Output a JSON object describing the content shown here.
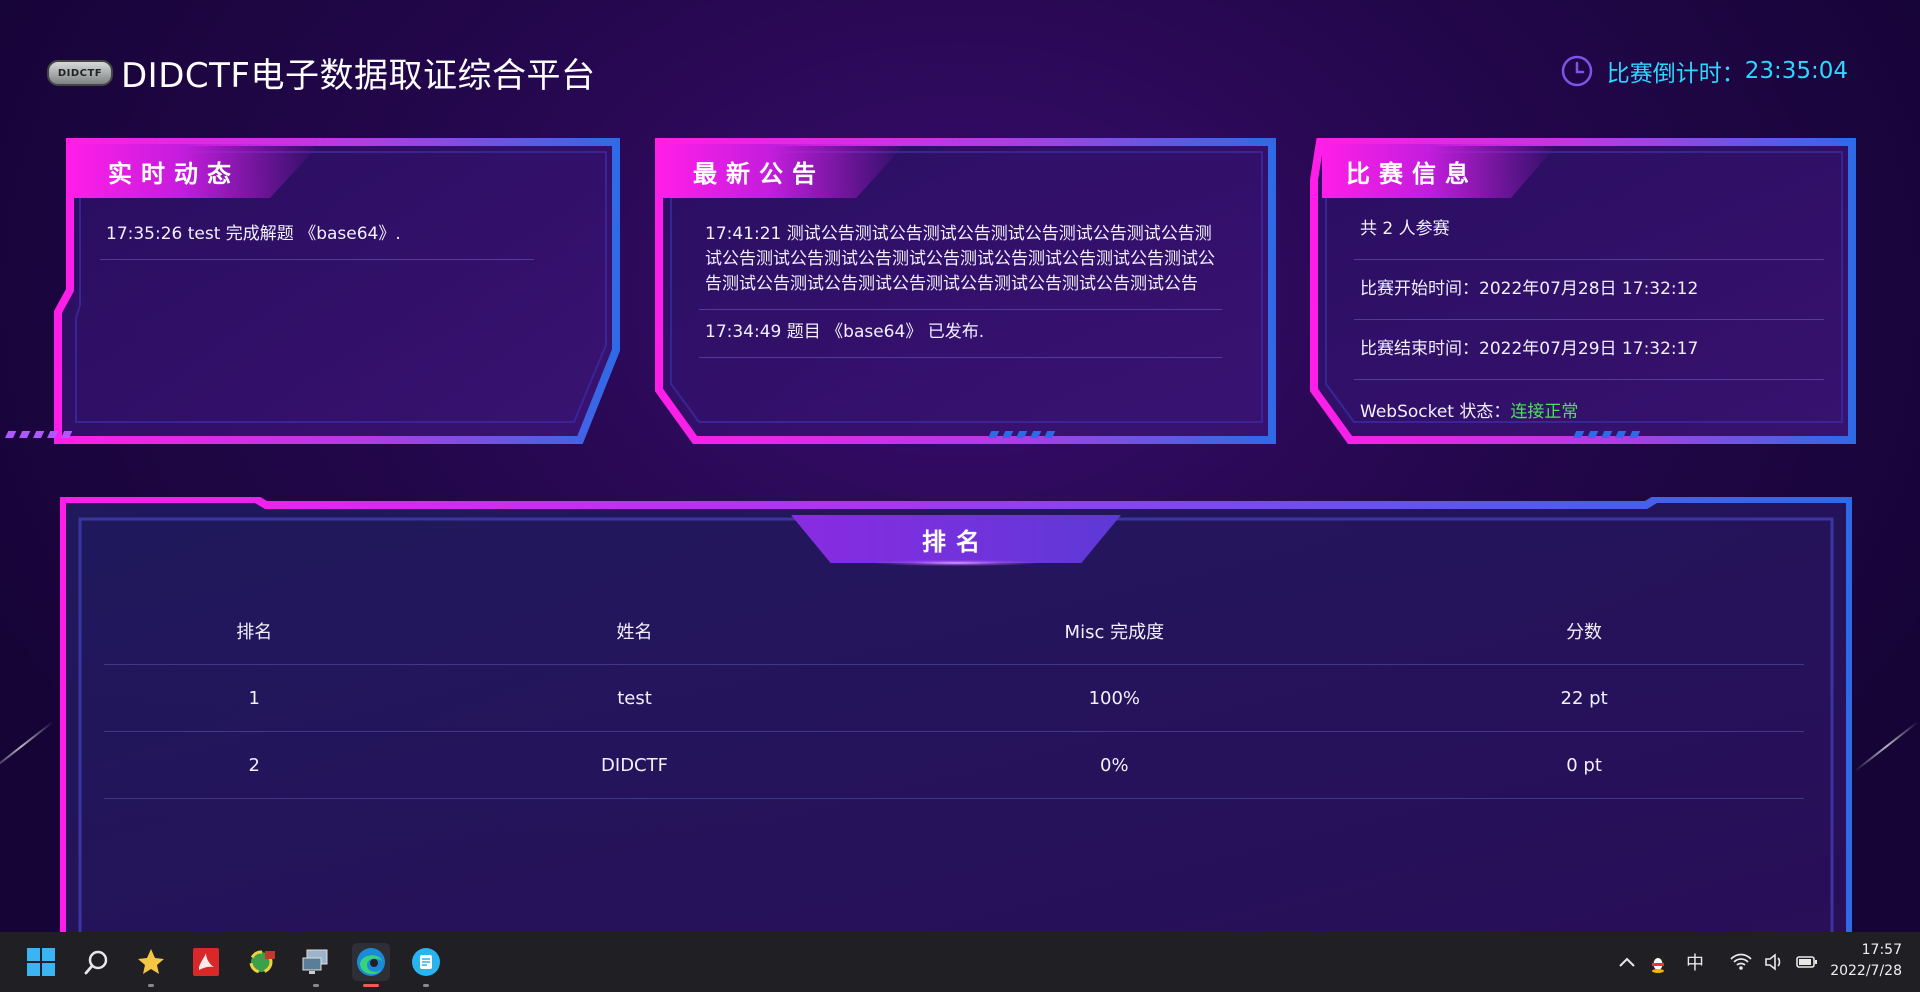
{
  "header": {
    "logo_text": "DIDCTF",
    "title": "DIDCTF电子数据取证综合平台",
    "countdown_label": "比赛倒计时：",
    "countdown_value": "23:35:04"
  },
  "panels": {
    "live": {
      "title": "实时动态",
      "items": [
        "17:35:26 test 完成解题 《base64》."
      ]
    },
    "notice": {
      "title": "最新公告",
      "items": [
        "17:41:21 测试公告测试公告测试公告测试公告测试公告测试公告测试公告测试公告测试公告测试公告测试公告测试公告测试公告测试公告测试公告测试公告测试公告测试公告测试公告测试公告测试公告",
        "17:34:49 题目 《base64》 已发布."
      ]
    },
    "info": {
      "title": "比赛信息",
      "participants": "共 2 人参赛",
      "start_label": "比赛开始时间：",
      "start_value": "2022年07月28日 17:32:12",
      "end_label": "比赛结束时间：",
      "end_value": "2022年07月29日 17:32:17",
      "ws_label": "WebSocket 状态：",
      "ws_value": "连接正常"
    }
  },
  "ranking": {
    "title": "排名",
    "columns": [
      "排名",
      "姓名",
      "Misc 完成度",
      "分数"
    ],
    "rows": [
      [
        "1",
        "test",
        "100%",
        "22 pt"
      ],
      [
        "2",
        "DIDCTF",
        "0%",
        "0 pt"
      ]
    ]
  },
  "taskbar": {
    "apps": [
      "start-icon",
      "search-icon",
      "star-app-icon",
      "pdf-app-icon",
      "network-app-icon",
      "remote-desktop-icon",
      "edge-browser-icon",
      "notes-app-icon"
    ],
    "tray_ime": "中",
    "time": "17:57",
    "date": "2022/7/28"
  },
  "colors": {
    "accent_cyan": "#2bd8ff",
    "panel_magenta": "#ff1ee8",
    "panel_blue": "#2f6ae6",
    "status_green": "#49e35a"
  }
}
